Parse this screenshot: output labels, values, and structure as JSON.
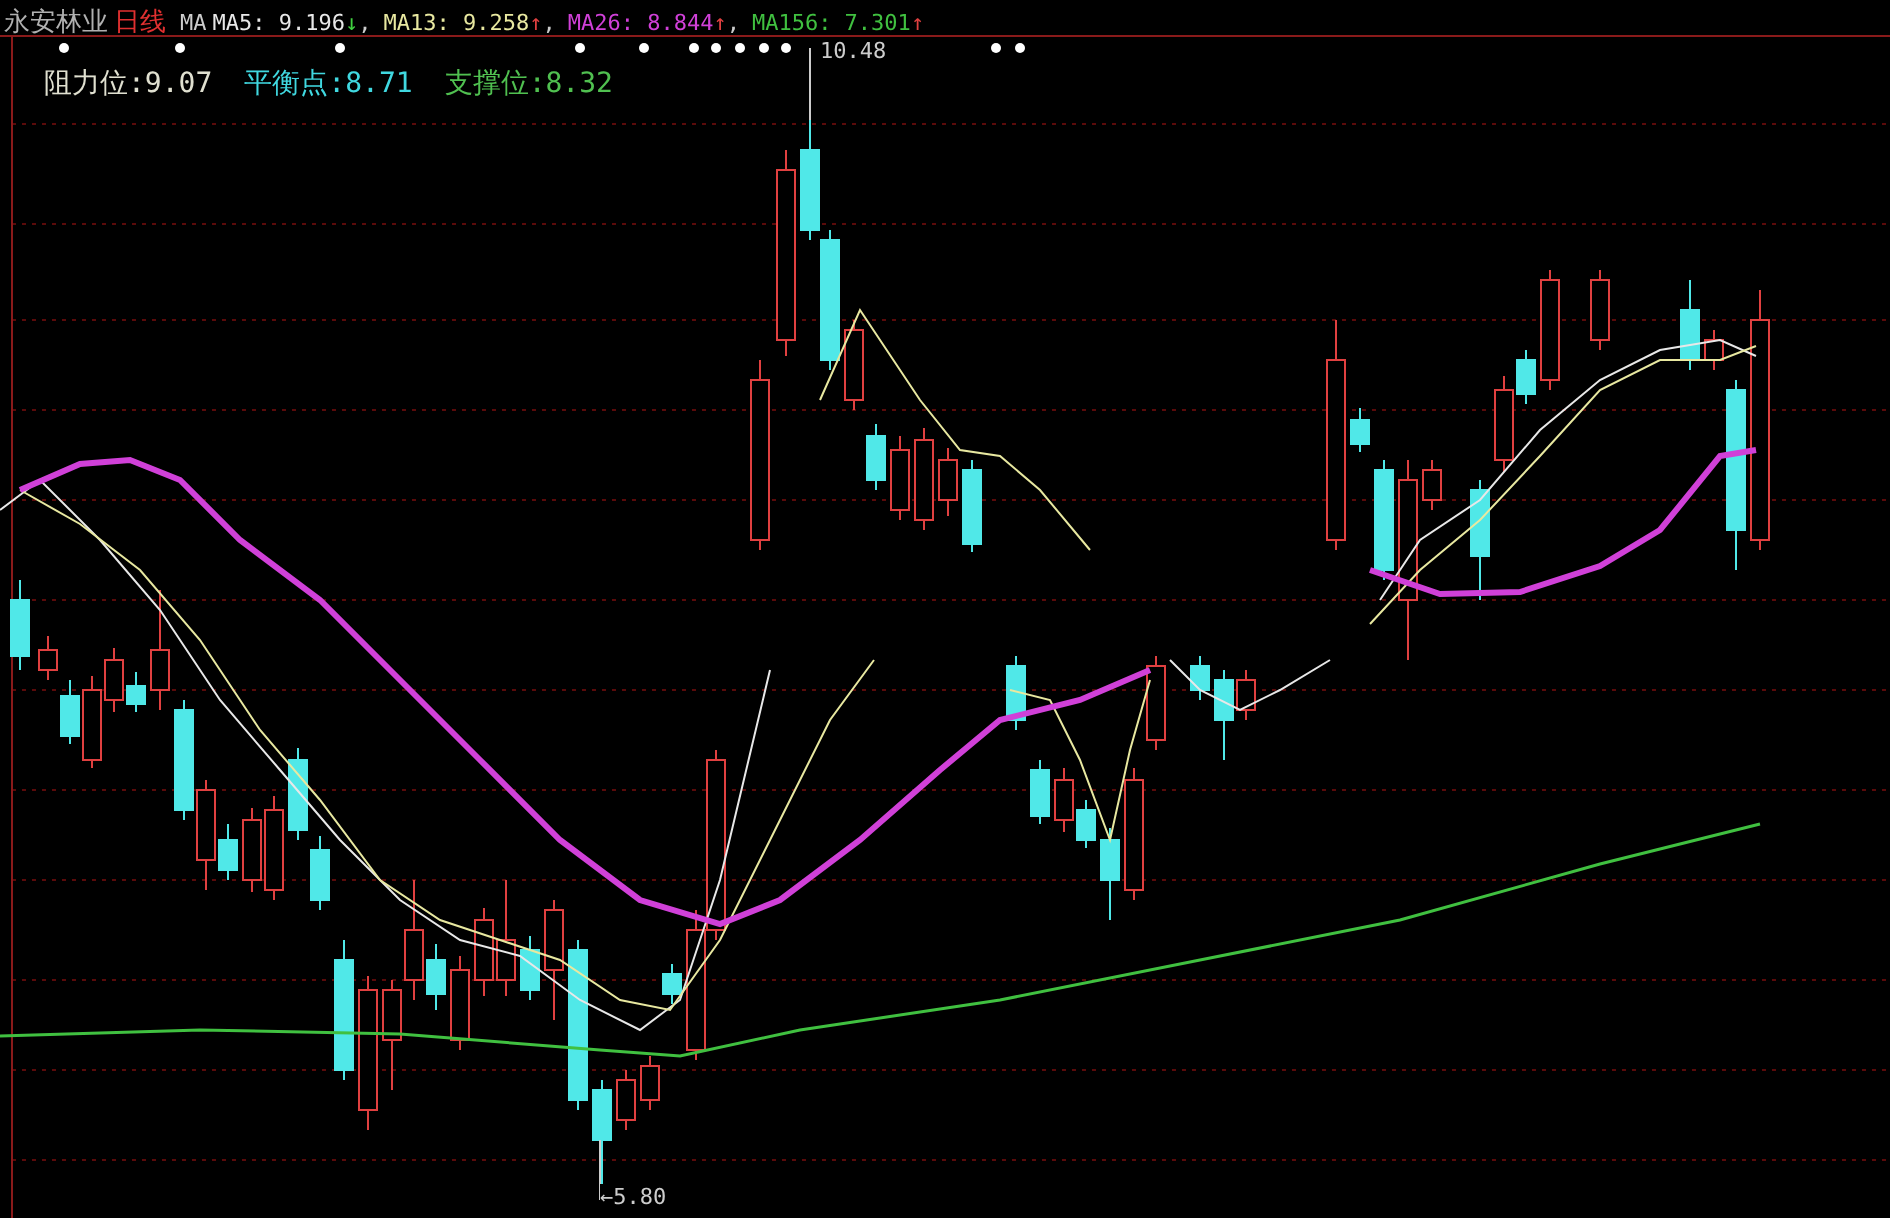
{
  "header": {
    "stock_name": "永安林业",
    "period": "日线",
    "indicator": "MA",
    "moving_averages": [
      {
        "label": "MA5:",
        "value": "9.196",
        "arrow": {
          "text": "↓",
          "color": "#40d040"
        },
        "separator": ",",
        "color": "#e8e8e8"
      },
      {
        "label": "MA13:",
        "value": "9.258",
        "arrow": {
          "text": "↑",
          "color": "#e04040"
        },
        "separator": ",",
        "color": "#e8e8a0"
      },
      {
        "label": "MA26:",
        "value": "8.844",
        "arrow": {
          "text": "↑",
          "color": "#e04040"
        },
        "separator": ",",
        "color": "#d040d8"
      },
      {
        "label": "MA156:",
        "value": "7.301",
        "arrow": {
          "text": "↑",
          "color": "#e04040"
        },
        "color": "#40c040"
      }
    ]
  },
  "levels": [
    {
      "text": "阻力位:9.07",
      "color": "#e0e0d0"
    },
    {
      "text": "平衡点:8.71",
      "color": "#40d8e0"
    },
    {
      "text": "支撑位:8.32",
      "color": "#50c050"
    }
  ],
  "price_marks": [
    {
      "kind": "high",
      "text": "10.48"
    },
    {
      "kind": "low",
      "text": "←5.80"
    }
  ]
}
